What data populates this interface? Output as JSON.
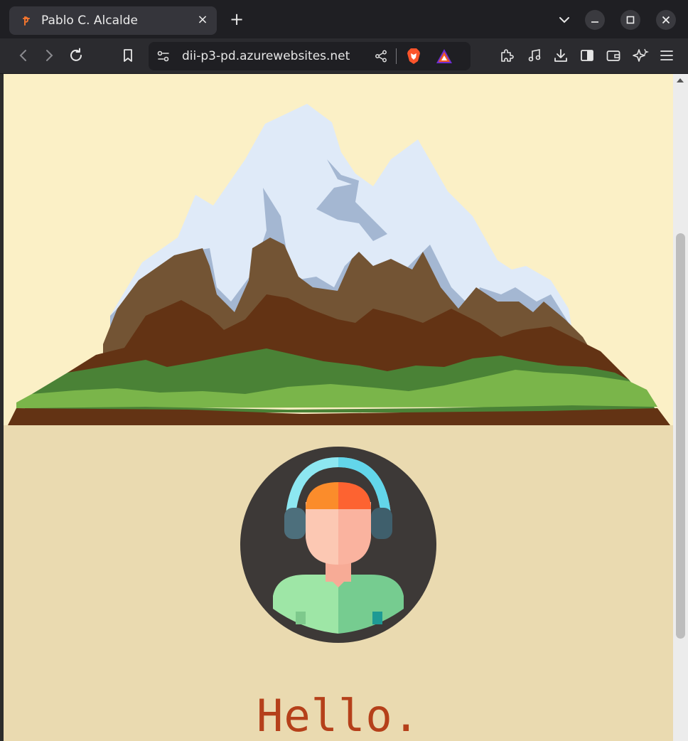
{
  "browser": {
    "tab_title": "Pablo C. Alcalde",
    "tab_close": "×",
    "new_tab": "+",
    "url": "dii-p3-pd.azurewebsites.net"
  },
  "page": {
    "greeting": "Hello."
  },
  "icons": {
    "tab_favicon": "pablo-logo-icon",
    "back": "chevron-left-icon",
    "forward": "chevron-right-icon",
    "reload": "reload-icon",
    "bookmark": "bookmark-icon",
    "site_info": "site-settings-icon",
    "share": "share-icon",
    "shields": "brave-shields-icon",
    "rewards": "brave-rewards-icon",
    "extensions": "puzzle-icon",
    "media": "music-note-icon",
    "downloads": "download-icon",
    "sidebar": "sidebar-icon",
    "wallet": "wallet-icon",
    "leo": "sparkle-icon",
    "menu": "hamburger-icon"
  },
  "colors": {
    "hero_bg": "#fbf0c6",
    "profile_bg": "#eadab0",
    "greeting": "#b5401a"
  }
}
